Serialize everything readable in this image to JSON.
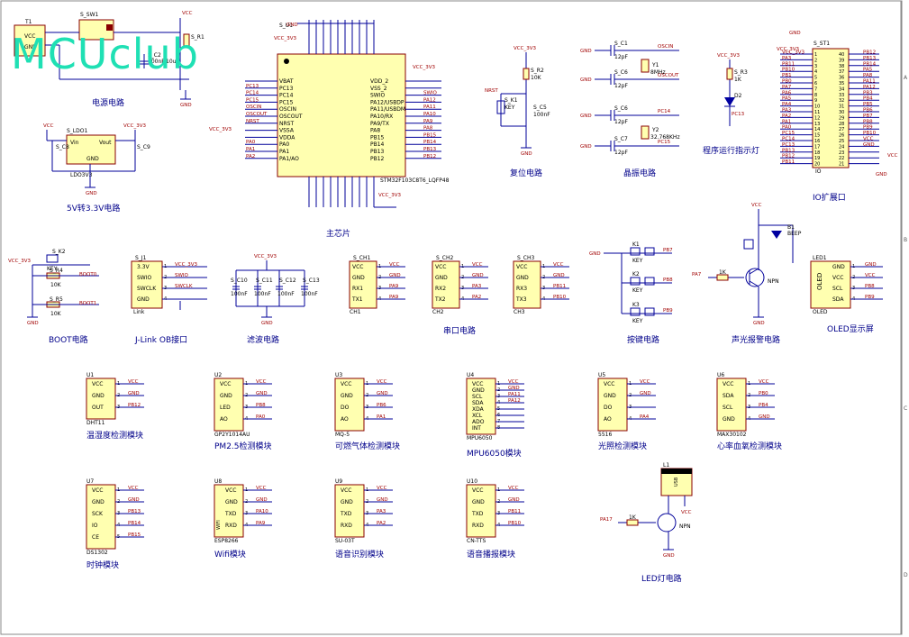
{
  "watermark": "MCUclub",
  "titles": {
    "power": "电源电路",
    "ldo": "5V转3.3V电路",
    "mcu": "主芯片",
    "reset": "复位电路",
    "crystal": "晶振电路",
    "led_run": "程序运行指示灯",
    "io": "IO扩展口",
    "boot": "BOOT电路",
    "jlink": "J-Link OB接口",
    "filter": "滤波电路",
    "serial": "串口电路",
    "keys": "按键电路",
    "alarm": "声光报警电路",
    "oled": "OLED显示屏",
    "dht": "温湿度检测模块",
    "pm25": "PM2.5检测模块",
    "gas": "可燃气体检测模块",
    "mpu": "MPU6050模块",
    "light": "光照检测模块",
    "heart": "心率血氧检测模块",
    "clock": "时钟模块",
    "wifi": "Wifi模块",
    "voice": "语音识别模块",
    "tts": "语音播报模块",
    "ledlight": "LED灯电路"
  },
  "refs": {
    "t1": "T1",
    "sw1": "S_SW1",
    "r1": "S_R1",
    "c2": "S_C2",
    "ldo1": "S_LDO1",
    "c8": "S_C8",
    "c9": "S_C9",
    "ldo_part": "LDO3V3",
    "u11": "S_U1",
    "mcu_part": "STM32F103C8T6_LQFP48",
    "r2": "S_R2",
    "k1": "S_K1",
    "c5": "S_C5",
    "c1": "S_C1",
    "c6": "S_C6",
    "c4": "S_C6",
    "c7": "S_C7",
    "y1": "Y1",
    "y2": "Y2",
    "r3": "S_R3",
    "d2": "D2",
    "st1": "S_ST1",
    "io_part": "IO",
    "k2": "S_K2",
    "r4": "S_R4",
    "r5": "S_R5",
    "j1": "S_J1",
    "link": "Link",
    "c10": "S_C10",
    "c11": "S_C11",
    "c12": "S_C12",
    "c13": "S_C13",
    "ch1": "S_CH1",
    "ch2": "S_CH2",
    "ch3": "S_CH3",
    "kk1": "K1",
    "kk2": "K2",
    "kk3": "K3",
    "b1": "B1",
    "oled": "LED1",
    "u1": "U1",
    "u2": "U2",
    "u3": "U3",
    "u4": "U4",
    "u5": "U5",
    "u6": "U6",
    "u7": "U7",
    "u8": "U8",
    "u9": "U9",
    "u10": "U10",
    "l1": "L1"
  },
  "nets": {
    "vcc": "VCC",
    "vcc33": "VCC_3V3",
    "gnd": "GND",
    "pb12": "PB12",
    "pb13": "PB13",
    "pb14": "PB14",
    "pb10": "PB10",
    "pb11": "PB11",
    "pa0": "PA0",
    "pa1": "PA1",
    "pa2": "PA2",
    "pa3": "PA3",
    "pa4": "PA4",
    "pa5": "PA5",
    "pa6": "PA6",
    "pa7": "PA7",
    "pa9": "PA9",
    "pa10": "PA10",
    "pa11": "PA11",
    "pa12": "PA12",
    "pa17": "PA17",
    "pb0": "PB0",
    "pb1": "PB1",
    "pb3": "PB3",
    "pb4": "PB4",
    "pb5": "PB5",
    "pb6": "PB6",
    "pb7": "PB7",
    "pb8": "PB8",
    "pb9": "PB9",
    "pc13": "PC13",
    "swio": "SWIO",
    "swclk": "SWCLK",
    "osc_in": "OSCIN",
    "osc_out": "OSCOUT",
    "pc14": "PC14",
    "pc15": "PC15",
    "nrst": "NRST",
    "boot0": "BOOT0",
    "boot1": "BOOT1",
    "beep": "BEEP",
    "usb": "USB"
  },
  "values": {
    "r10k": "10K",
    "r1k": "1K",
    "c100n": "100nF",
    "c10u": "10uF",
    "c1u": "1uF",
    "c12p": "12pF",
    "c100nf": "100nF",
    "y1": "8MHz",
    "y2": "32.768KHz",
    "key": "KEY",
    "npn": "NPN",
    "v33": "3.3V"
  },
  "mcu_left": [
    "VBAT",
    "PC13",
    "PC14",
    "PC15",
    "OSCIN",
    "OSCOUT",
    "NRST",
    "VSSA",
    "VDDA",
    "PA0",
    "PA1",
    "PA1/AO"
  ],
  "mcu_left_nets": [
    "",
    "PC13",
    "PC14",
    "PC15",
    "OSCIN",
    "OSCOUT",
    "NRST",
    "",
    "",
    "PA0",
    "PA1",
    "PA2"
  ],
  "mcu_right": [
    "VDD_2",
    "VSS_2",
    "SWIO",
    "PA12/USBDP",
    "PA11/USBDM",
    "PA10/RX",
    "PA9/TX",
    "PA8",
    "PB15",
    "PB14",
    "PB13",
    "PB12"
  ],
  "mcu_right_nets": [
    "",
    "",
    "SWIO",
    "PA12",
    "PA11",
    "PA10",
    "PA9",
    "PA8",
    "PB15",
    "PB14",
    "PB13",
    "PB12"
  ],
  "io_left": [
    "VCC_3V3",
    "PA3",
    "PB11",
    "PB10",
    "PB1",
    "PB0",
    "PA7",
    "PA6",
    "PA5",
    "PA4",
    "PA3",
    "PA2",
    "PA1",
    "PA0",
    "PC15",
    "PC14",
    "PC13",
    "PB13",
    "PB12",
    "PB11",
    "PB10"
  ],
  "io_right": [
    "PB12",
    "PB13",
    "PB14",
    "PA5",
    "PA8",
    "PA11",
    "PA12",
    "PB3",
    "PB4",
    "PB5",
    "PB6",
    "PB7",
    "PB8",
    "PB9",
    "PB10",
    "VCC",
    "GND"
  ],
  "jlink_pins": [
    "3.3V",
    "SWIO",
    "SWCLK",
    "GND"
  ],
  "jlink_nets": [
    "VCC_3V3",
    "SWIO",
    "SWCLK",
    ""
  ],
  "serial_pins": [
    "VCC",
    "GND",
    "RX1",
    "TX1"
  ],
  "serial1_nets": [
    "VCC",
    "GND",
    "PA9",
    "PA9"
  ],
  "serial2_pins": [
    "VCC",
    "GND",
    "RX2",
    "TX2"
  ],
  "serial2_nets": [
    "VCC",
    "GND",
    "PA3",
    "PA2"
  ],
  "serial3_pins": [
    "VCC",
    "GND",
    "RX3",
    "TX3"
  ],
  "serial3_nets": [
    "VCC",
    "GND",
    "PB11",
    "PB10"
  ],
  "ch_labels": [
    "CH1",
    "CH2",
    "CH3"
  ],
  "oled_pins": [
    "GND",
    "VCC",
    "SCL",
    "SDA"
  ],
  "oled_nets": [
    "GND",
    "VCC",
    "PB8",
    "PB9"
  ],
  "oled_name": "OLED",
  "modules": [
    {
      "ref": "U1",
      "part": "DHT11",
      "pins": [
        "VCC",
        "GND",
        "OUT"
      ],
      "nets": [
        "VCC",
        "GND",
        "PB12"
      ],
      "title": "温湿度检测模块"
    },
    {
      "ref": "U2",
      "part": "GP2Y1014AU",
      "pins": [
        "VCC",
        "GND",
        "LED",
        "AO"
      ],
      "nets": [
        "VCC",
        "GND",
        "PB8",
        "PA0"
      ],
      "title": "PM2.5检测模块"
    },
    {
      "ref": "U3",
      "part": "MQ-5",
      "pins": [
        "VCC",
        "GND",
        "DO",
        "AO"
      ],
      "nets": [
        "VCC",
        "GND",
        "PB6",
        "PA1"
      ],
      "title": "可燃气体检测模块"
    },
    {
      "ref": "U4",
      "part": "MPU6050",
      "pins": [
        "VCC",
        "GND",
        "SCL",
        "SDA",
        "XDA",
        "XCL",
        "ADO",
        "INT"
      ],
      "nets": [
        "VCC",
        "GND",
        "PA11",
        "PA12",
        "",
        "",
        "",
        ""
      ],
      "title": "MPU6050模块"
    },
    {
      "ref": "U5",
      "part": "5516",
      "pins": [
        "VCC",
        "GND",
        "DO",
        "AO"
      ],
      "nets": [
        "VCC",
        "GND",
        "",
        "PA4"
      ],
      "title": "光照检测模块"
    },
    {
      "ref": "U6",
      "part": "MAX30102",
      "pins": [
        "VCC",
        "SDA",
        "SCL",
        "GND"
      ],
      "nets": [
        "VCC",
        "PB0",
        "PB4",
        "GND"
      ],
      "title": "心率血氧检测模块"
    },
    {
      "ref": "U7",
      "part": "DS1302",
      "pins": [
        "VCC",
        "GND",
        "SCK",
        "IO",
        "CE"
      ],
      "nets": [
        "VCC",
        "GND",
        "PB13",
        "PB14",
        "PB15"
      ],
      "title": "时钟模块"
    },
    {
      "ref": "U8",
      "part": "ESP8266",
      "pins": [
        "VCC",
        "GND",
        "TXD",
        "RXD"
      ],
      "nets": [
        "VCC",
        "GND",
        "PA10",
        "PA9"
      ],
      "title": "Wifi模块",
      "side": "WIFI"
    },
    {
      "ref": "U9",
      "part": "SU-03T",
      "pins": [
        "VCC",
        "GND",
        "TXD",
        "RXD"
      ],
      "nets": [
        "VCC",
        "GND",
        "PA3",
        "PA2"
      ],
      "title": "语音识别模块"
    },
    {
      "ref": "U10",
      "part": "CN-TTS",
      "pins": [
        "VCC",
        "GND",
        "TXD",
        "RXD"
      ],
      "nets": [
        "VCC",
        "GND",
        "PB11",
        "PB10"
      ],
      "title": "语音播报模块"
    }
  ],
  "zones": {
    "left": [
      "A",
      "B",
      "C",
      "D"
    ],
    "right": [
      "A",
      "B",
      "C",
      "D"
    ]
  },
  "colors": {
    "wire": "#00009a",
    "outline": "#8a0000",
    "fill": "#ffffb0",
    "net": "#a00000",
    "title": "#00008a",
    "watermark": "#1fe0b4"
  }
}
